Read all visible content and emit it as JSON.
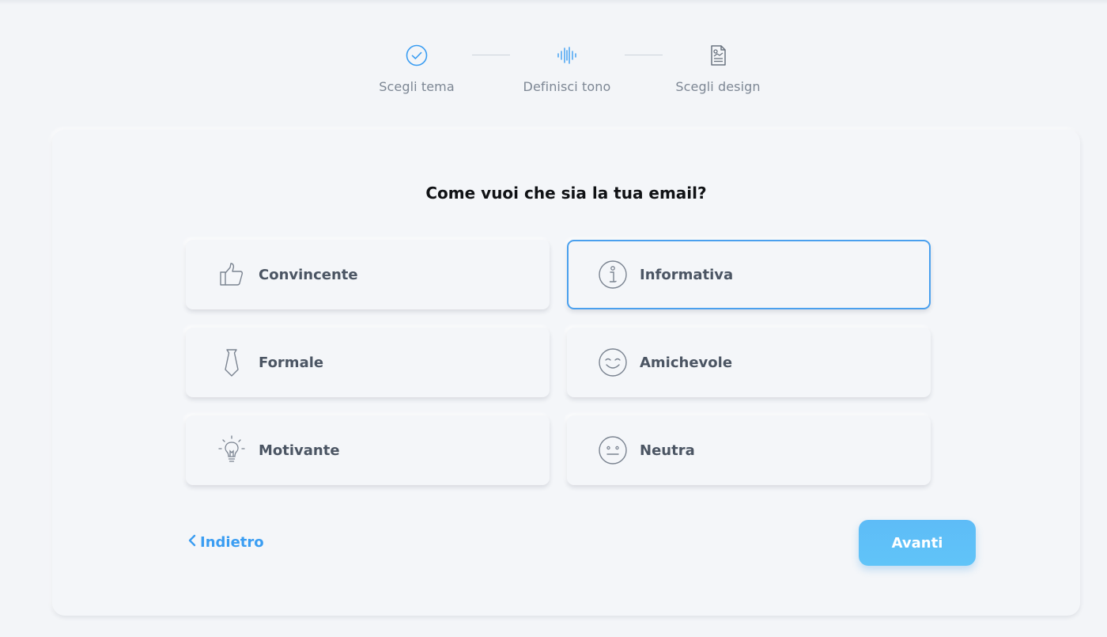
{
  "stepper": {
    "steps": [
      {
        "label": "Scegli tema",
        "icon": "check-circle-icon",
        "state": "completed"
      },
      {
        "label": "Definisci tono",
        "icon": "soundwave-icon",
        "state": "current"
      },
      {
        "label": "Scegli design",
        "icon": "document-icon",
        "state": "pending"
      }
    ]
  },
  "card": {
    "question": "Come vuoi che sia la tua email?",
    "options": [
      {
        "label": "Convincente",
        "icon": "thumbs-up-icon",
        "selected": false
      },
      {
        "label": "Informativa",
        "icon": "info-icon",
        "selected": true
      },
      {
        "label": "Formale",
        "icon": "tie-icon",
        "selected": false
      },
      {
        "label": "Amichevole",
        "icon": "smile-icon",
        "selected": false
      },
      {
        "label": "Motivante",
        "icon": "lightbulb-icon",
        "selected": false
      },
      {
        "label": "Neutra",
        "icon": "neutral-face-icon",
        "selected": false
      }
    ],
    "back_label": "Indietro",
    "next_label": "Avanti"
  },
  "colors": {
    "accent": "#4aa0ee",
    "button": "#5ebcf7",
    "background": "#f3f5f8",
    "text_dark": "#101215",
    "text_muted": "#7d8794"
  }
}
